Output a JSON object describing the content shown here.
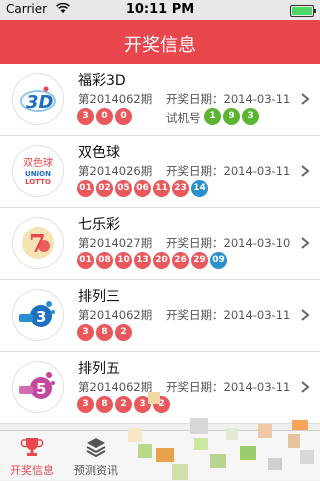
{
  "status_bar": {
    "carrier": "Carrier",
    "time": "10:11 PM"
  },
  "header": {
    "title": "开奖信息"
  },
  "colors": {
    "brand": "#e9474d",
    "red_ball": "#e8585d",
    "blue_ball": "#2a8fd0",
    "green_ball": "#5cb531"
  },
  "lotteries": [
    {
      "name": "福彩3D",
      "issue": "第2014062期",
      "date": "开奖日期：2014-03-11",
      "red": [
        "3",
        "0",
        "0"
      ],
      "blue": [],
      "trial_label": "试机号",
      "trial": [
        "1",
        "9",
        "3"
      ],
      "icon": "fc3d-logo"
    },
    {
      "name": "双色球",
      "issue": "第2014026期",
      "date": "开奖日期：2014-03-11",
      "red": [
        "01",
        "02",
        "05",
        "06",
        "11",
        "23"
      ],
      "blue": [
        "14"
      ],
      "icon": "ssq-logo",
      "logo_text": {
        "top": "双色球",
        "mid": "UNION",
        "bot": "LOTTO"
      }
    },
    {
      "name": "七乐彩",
      "issue": "第2014027期",
      "date": "开奖日期：2014-03-10",
      "red": [
        "01",
        "08",
        "10",
        "13",
        "20",
        "26",
        "29"
      ],
      "blue": [
        "09"
      ],
      "icon": "qlc-logo",
      "logo_text": {
        "num": "7"
      }
    },
    {
      "name": "排列三",
      "issue": "第2014062期",
      "date": "开奖日期：2014-03-11",
      "red": [
        "3",
        "8",
        "2"
      ],
      "blue": [],
      "icon": "pl3-logo",
      "logo_text": {
        "num": "3"
      }
    },
    {
      "name": "排列五",
      "issue": "第2014062期",
      "date": "开奖日期：2014-03-11",
      "red": [
        "3",
        "8",
        "2",
        "3",
        "2"
      ],
      "blue": [],
      "icon": "pl5-logo",
      "logo_text": {
        "num": "5"
      }
    }
  ],
  "tabs": [
    {
      "label": "开奖信息",
      "icon": "trophy-icon",
      "active": true
    },
    {
      "label": "预测资讯",
      "icon": "layers-icon",
      "active": false
    }
  ]
}
